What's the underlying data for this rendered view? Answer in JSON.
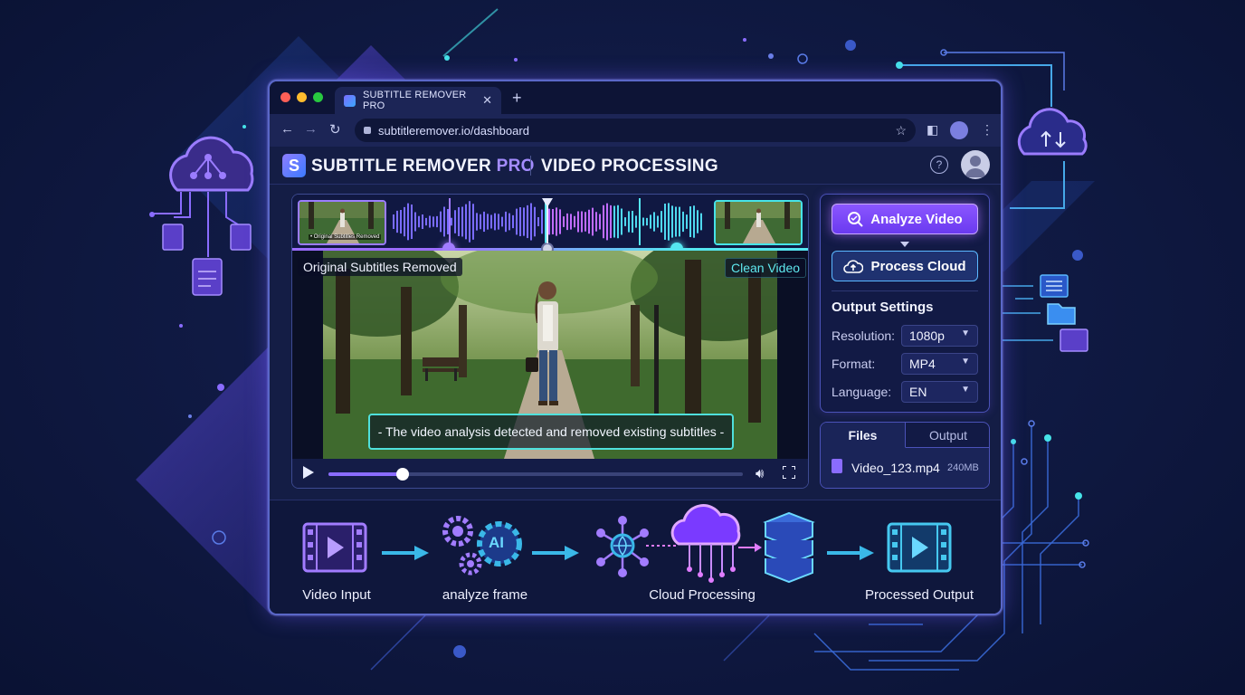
{
  "browser": {
    "tab_title": "SUBTITLE REMOVER PRO",
    "url": "subtitleremover.io/dashboard"
  },
  "app": {
    "brand_main": "SUBTITLE REMOVER ",
    "brand_accent": "PRO",
    "page_title": "VIDEO PROCESSING"
  },
  "video": {
    "thumb_caption": "• Original Subtitles Removed",
    "label_original": "Original Subtitles Removed",
    "label_clean": "Clean Video",
    "subtitle": "- The video analysis detected and removed existing subtitles -",
    "playback_progress": 0.18
  },
  "actions": {
    "analyze": "Analyze Video",
    "process": "Process Cloud"
  },
  "settings": {
    "title": "Output Settings",
    "resolution_label": "Resolution:",
    "resolution_value": "1080p",
    "format_label": "Format:",
    "format_value": "MP4",
    "language_label": "Language:",
    "language_value": "EN"
  },
  "files": {
    "tab_files": "Files",
    "tab_output": "Output",
    "file_name": "Video_123.mp4",
    "file_size": "240MB"
  },
  "workflow": {
    "step1": "Video Input",
    "step2": "analyze frame",
    "step2_badge": "AI",
    "step3": "Cloud Processing",
    "step4": "Processed Output"
  },
  "colors": {
    "accent_purple": "#8a6cff",
    "accent_cyan": "#46e3e8",
    "background": "#101a44"
  }
}
